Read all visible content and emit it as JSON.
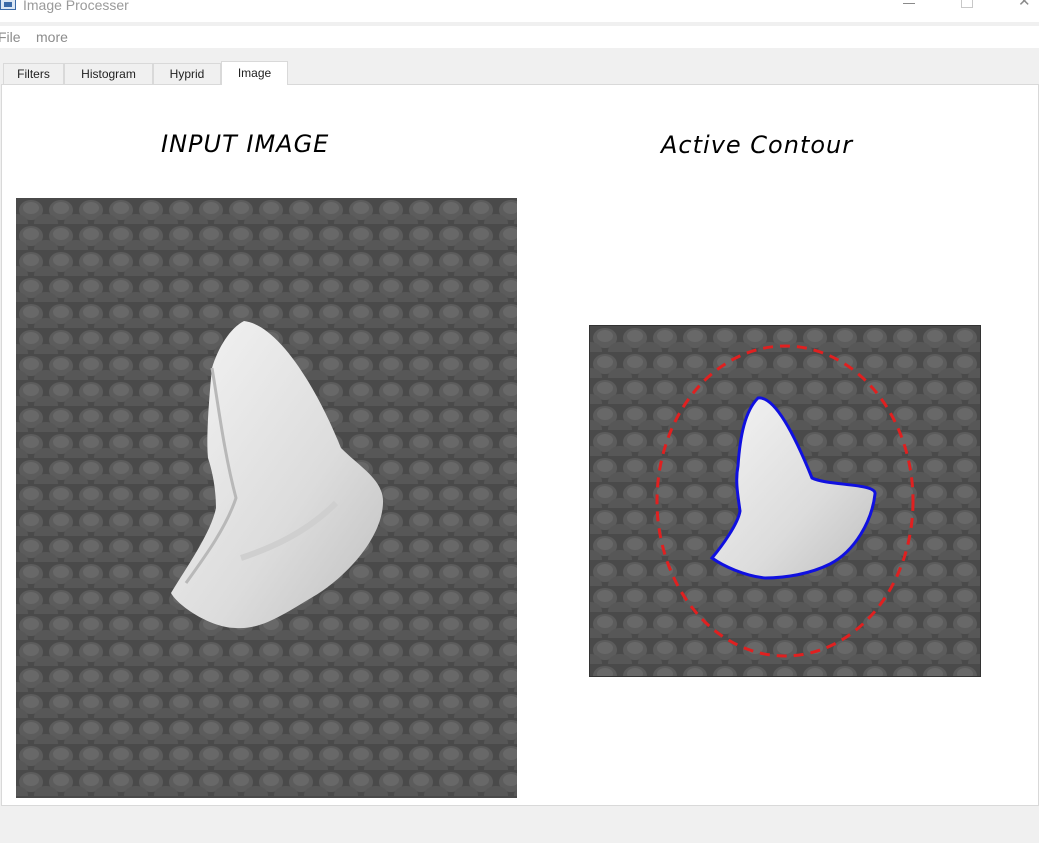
{
  "window": {
    "title": "Image Processer",
    "controls": {
      "minimize": "—",
      "maximize": "☐",
      "close": "✕"
    }
  },
  "menu": {
    "file": "File",
    "more": "more"
  },
  "tabs": [
    {
      "label": "Filters"
    },
    {
      "label": "Histogram"
    },
    {
      "label": "Hyprid"
    },
    {
      "label": "Image",
      "active": true
    }
  ],
  "panels": {
    "input": {
      "heading": "INPUT IMAGE",
      "subject": "shark-tooth"
    },
    "output": {
      "heading": "Active Contour",
      "contour_colors": {
        "initial": "#e02020",
        "final": "#1010e0"
      }
    }
  },
  "colors": {
    "background": "#f0f0f0",
    "panel": "#ffffff",
    "accent_red": "#e02020",
    "accent_blue": "#1010e0"
  }
}
